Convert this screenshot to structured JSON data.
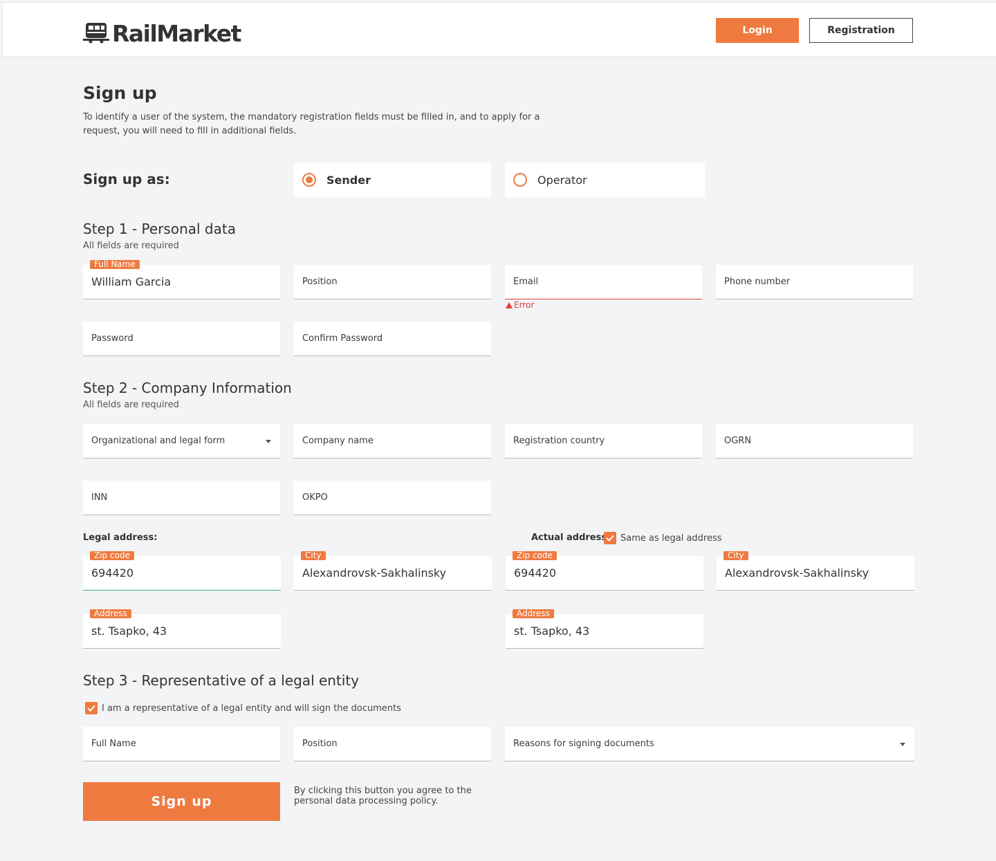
{
  "header": {
    "brand": "RailMarket",
    "login_label": "Login",
    "registration_label": "Registration"
  },
  "page": {
    "title": "Sign up",
    "intro": "To identify a user of the system, the mandatory registration fields must be filled in, and to apply for a request, you will need to fill in additional fields.",
    "sign_up_as_label": "Sign up as:",
    "roles": [
      {
        "label": "Sender",
        "selected": true
      },
      {
        "label": "Operator",
        "selected": false
      }
    ]
  },
  "step1": {
    "title": "Step 1 - Personal data",
    "subtitle": "All fields are required",
    "full_name_tag": "Full Name",
    "full_name_value": "William Garcia",
    "position_placeholder": "Position",
    "email_placeholder": "Email",
    "email_error": "Error",
    "phone_placeholder": "Phone number",
    "password_placeholder": "Password",
    "confirm_password_placeholder": "Confirm Password"
  },
  "step2": {
    "title": "Step 2 - Company Information",
    "subtitle": "All fields are required",
    "org_form_placeholder": "Organizational and legal form",
    "company_name_placeholder": "Company name",
    "registration_country_placeholder": "Registration country",
    "ogrn_placeholder": "OGRN",
    "inn_placeholder": "INN",
    "okpo_placeholder": "OKPO",
    "legal_address_label": "Legal address:",
    "actual_address_label": "Actual address:",
    "same_as_legal_label": "Same as legal address",
    "same_as_legal_checked": true,
    "legal": {
      "zip_tag": "Zip code",
      "zip_value": "694420",
      "city_tag": "City",
      "city_value": "Alexandrovsk-Sakhalinsky",
      "address_tag": "Address",
      "address_value": "st. Tsapko, 43"
    },
    "actual": {
      "zip_tag": "Zip code",
      "zip_value": "694420",
      "city_tag": "City",
      "city_value": "Alexandrovsk-Sakhalinsky",
      "address_tag": "Address",
      "address_value": "st. Tsapko, 43"
    }
  },
  "step3": {
    "title": "Step 3 - Representative of a legal entity",
    "representative_label": "I am a representative of a legal entity and will sign the documents",
    "representative_checked": true,
    "full_name_placeholder": "Full Name",
    "position_placeholder": "Position",
    "reasons_placeholder": "Reasons for signing documents"
  },
  "footer": {
    "signup_label": "Sign up",
    "policy_text": "By clicking this button you agree to the personal data processing policy."
  },
  "colors": {
    "accent": "#ef7a40",
    "error": "#e53935",
    "focus": "#2fa87a",
    "background": "#f3f4f5"
  }
}
